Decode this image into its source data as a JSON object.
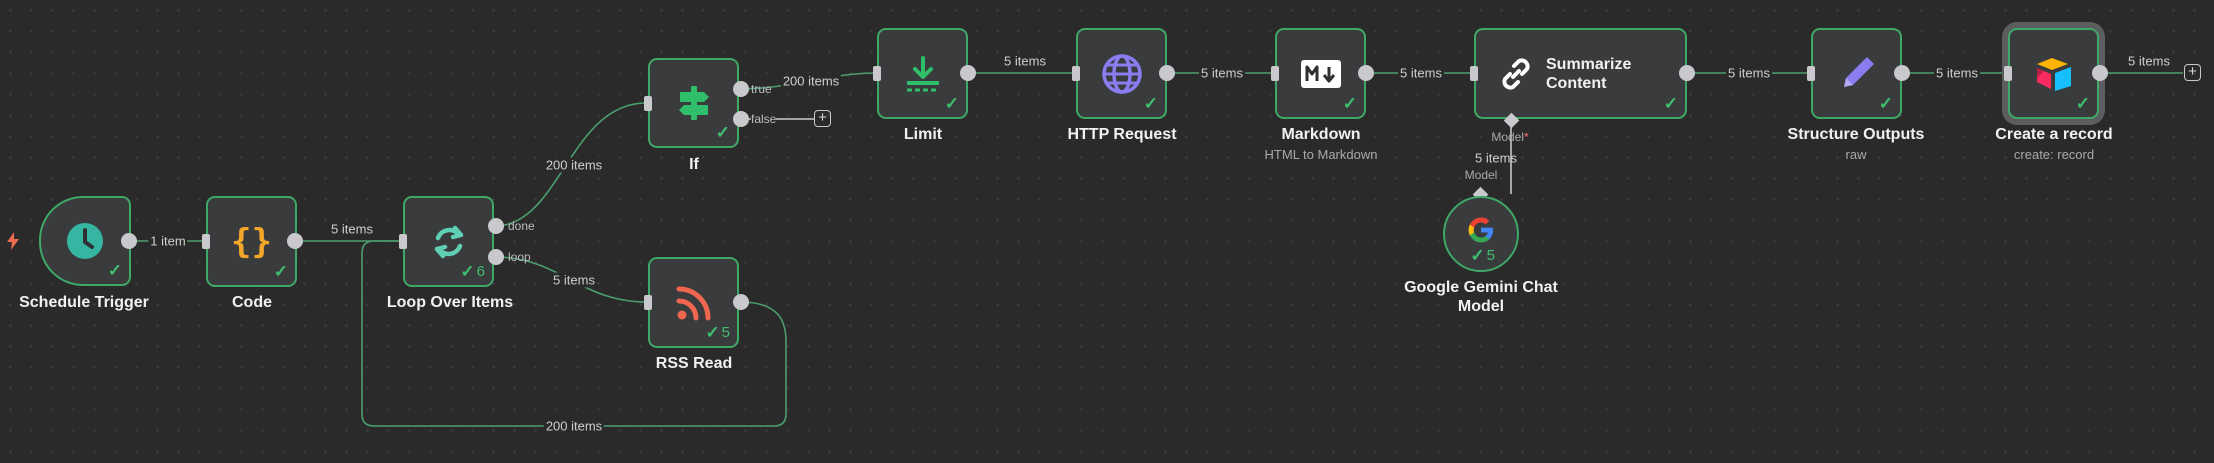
{
  "nodes": {
    "schedule": {
      "label": "Schedule Trigger"
    },
    "code": {
      "label": "Code"
    },
    "loop": {
      "label": "Loop Over Items",
      "count": "6",
      "done_label": "done",
      "loop_label": "loop"
    },
    "if": {
      "label": "If",
      "true_label": "true",
      "false_label": "false"
    },
    "rss": {
      "label": "RSS Read",
      "count": "5"
    },
    "limit": {
      "label": "Limit"
    },
    "http": {
      "label": "HTTP Request"
    },
    "markdown": {
      "label": "Markdown",
      "subtitle": "HTML to Markdown"
    },
    "summarize": {
      "label": "Summarize Content",
      "model_port_label": "Model",
      "model_required": "*"
    },
    "gemini": {
      "label": "Google Gemini Chat Model",
      "count": "5",
      "model_label": "Model"
    },
    "structure": {
      "label": "Structure Outputs",
      "subtitle": "raw"
    },
    "airtable": {
      "label": "Create a record",
      "subtitle": "create: record"
    }
  },
  "edges": {
    "schedule_code": "1 item",
    "code_loop": "5 items",
    "loop_if": "200 items",
    "loop_rss": "5 items",
    "rss_loop": "200 items",
    "if_limit": "200 items",
    "limit_http": "5 items",
    "http_markdown": "5 items",
    "markdown_summarize": "5 items",
    "gemini_summarize": "5 items",
    "summarize_structure": "5 items",
    "structure_airtable": "5 items",
    "airtable_out": "5 items"
  },
  "icons": {
    "check": "✓",
    "plus": "+"
  },
  "colors": {
    "node_border": "#3fa867",
    "success": "#3fbf6e",
    "canvas": "#2a2a2b"
  }
}
